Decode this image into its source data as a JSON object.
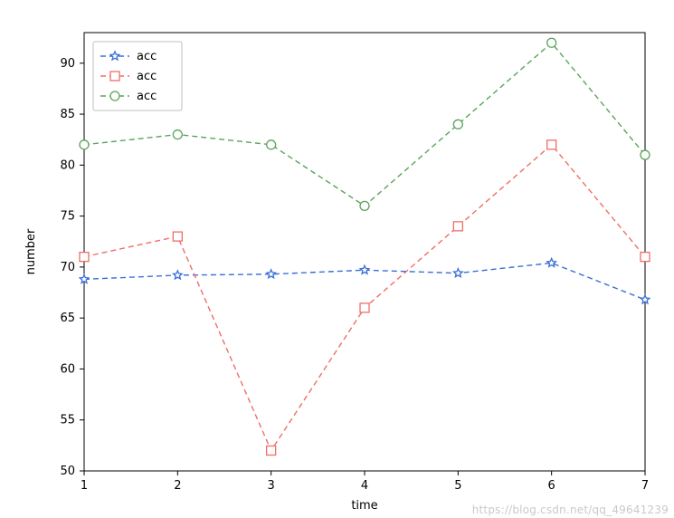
{
  "chart_data": {
    "type": "line",
    "xlabel": "time",
    "ylabel": "number",
    "x": [
      1,
      2,
      3,
      4,
      5,
      6,
      7
    ],
    "ylim": [
      50,
      93
    ],
    "y_ticks": [
      50,
      55,
      60,
      65,
      70,
      75,
      80,
      85,
      90
    ],
    "series": [
      {
        "name": "acc",
        "color": "#3b6fd6",
        "marker": "star",
        "values": [
          68.8,
          69.2,
          69.3,
          69.7,
          69.4,
          70.4,
          66.8
        ]
      },
      {
        "name": "acc",
        "color": "#ef6e68",
        "marker": "square",
        "values": [
          71,
          73,
          52,
          66,
          74,
          82,
          71
        ]
      },
      {
        "name": "acc",
        "color": "#5ca35c",
        "marker": "circle",
        "values": [
          82,
          83,
          82,
          76,
          84,
          92,
          81
        ]
      }
    ],
    "legend": {
      "loc": "upper-left"
    }
  },
  "watermark": "https://blog.csdn.net/qq_49641239"
}
